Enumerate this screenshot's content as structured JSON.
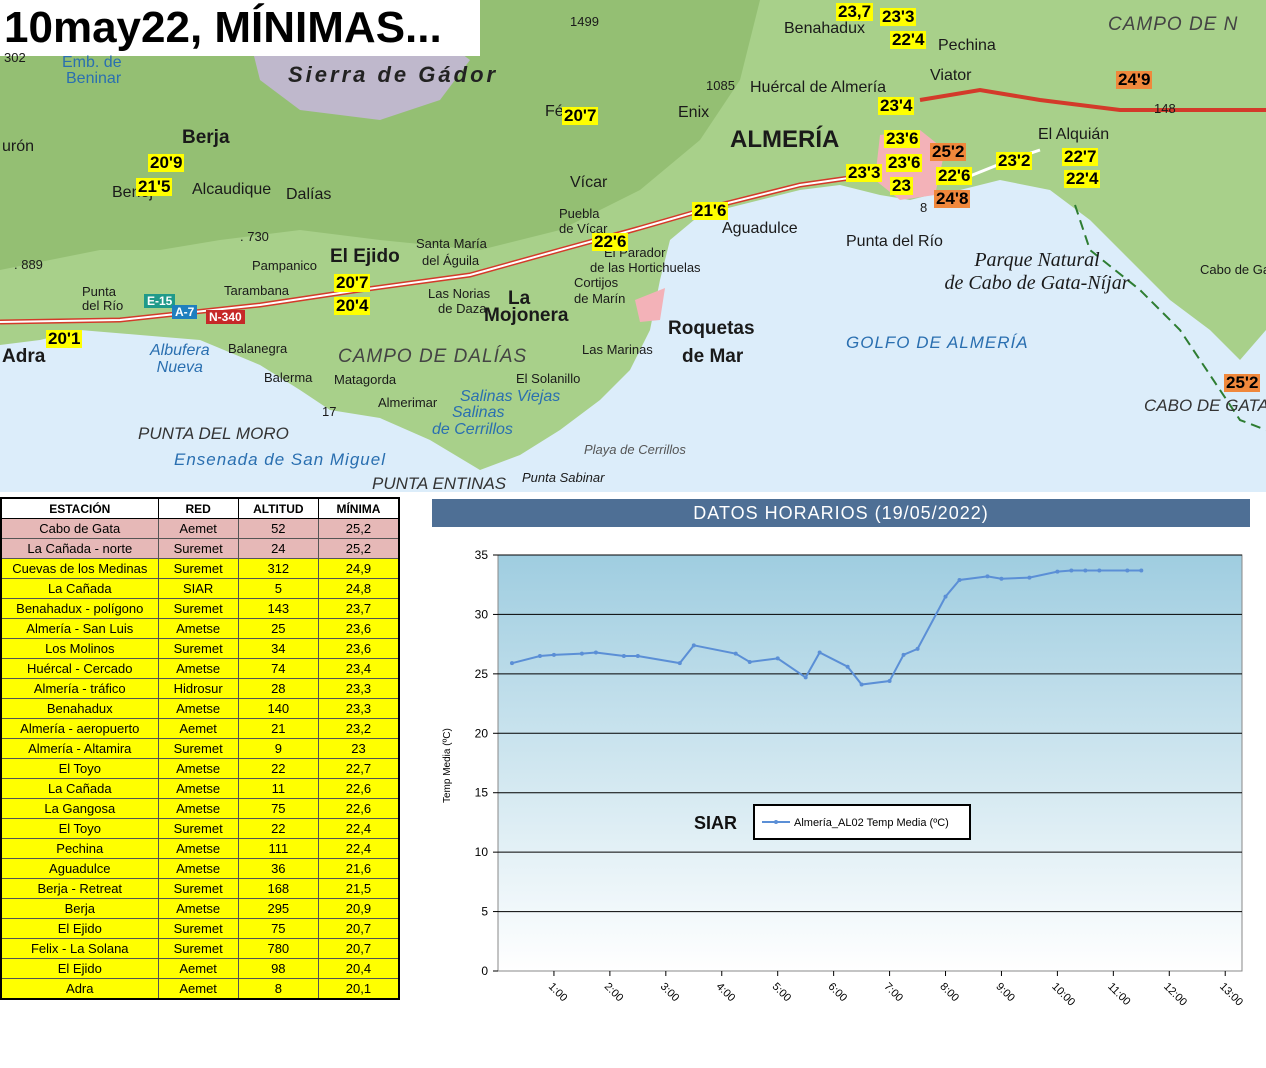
{
  "map": {
    "title": "10may22, MÍNIMAS...",
    "places": {
      "almeria": "ALMERÍA",
      "berja": "Berja",
      "dalias": "Dalías",
      "el_ejido": "El Ejido",
      "adra": "Adra",
      "roquetas": "Roquetas",
      "de_mar": "de Mar",
      "la_mojonera": "La",
      "la_mojonera2": "Mojonera",
      "benahadux": "Benahadux",
      "huercal": "Huércal de Almería",
      "viator": "Viator",
      "pechina": "Pechina",
      "enix": "Enix",
      "vicar": "Vícar",
      "felix": "Fé",
      "el_alquian": "El Alquián",
      "aguadulce": "Aguadulce",
      "punta_del_rio": "Punta del Río",
      "alcaudique": "Alcaudique",
      "benej": "Benej",
      "santa_maria": "Santa María",
      "del_aguila": "del Águila",
      "las_norias": "Las Norias",
      "de_daza": "de Daza",
      "pampanico": "Pampanico",
      "tarambana": "Tarambana",
      "balanegra": "Balanegra",
      "balerma": "Balerma",
      "matagorda": "Matagorda",
      "almerimar": "Almerimar",
      "el_solanillo": "El Solanillo",
      "las_marinas": "Las Marinas",
      "cortijos": "Cortijos",
      "de_marin": "de Marín",
      "el_parador": "El Parador",
      "de_las_hortichuelas": "de las Hortichuelas",
      "puebla": "Puebla",
      "de_vicar": "de Vícar",
      "punta_de_rio_w": "Punta",
      "del_rio_w": "del Río",
      "cabo_de_gata_town": "Cabo de Gat",
      "duron": "urón",
      "emb": "Emb. de",
      "beninar": "Beninar"
    },
    "regions": {
      "sierra": "Sierra de Gádor",
      "campo_dalias": "CAMPO DE DALÍAS",
      "campo_nijar": "CAMPO DE N",
      "parque1": "Parque Natural",
      "parque2": "de Cabo de Gata-Níjar",
      "golfo": "GOLFO DE ALMERÍA",
      "albufera1": "Albufera",
      "albufera2": "Nueva",
      "salinas1": "Salinas Viejas",
      "salinas2": "Salinas",
      "salinas3": "de Cerrillos",
      "playa": "Playa de Cerrillos",
      "punta_moro": "PUNTA DEL MORO",
      "ensenada": "Ensenada de San Miguel",
      "punta_entinas": "PUNTA ENTINAS",
      "punta_sabinar": "Punta Sabinar",
      "cabo_gata": "CABO DE GATA"
    },
    "elevations": {
      "e1499": "1499",
      "e1085": "1085",
      "e730": ". 730",
      "e889": ". 889",
      "e148": "148",
      "e302": "302",
      "e17": "17",
      "e8": "8"
    },
    "roads": {
      "e15": "E-15",
      "a7": "A-7",
      "n340": "N-340"
    },
    "temperatures": [
      {
        "id": "t1",
        "value": "23,7",
        "hot": false
      },
      {
        "id": "t2",
        "value": "23'3",
        "hot": false
      },
      {
        "id": "t3",
        "value": "22'4",
        "hot": false
      },
      {
        "id": "t4",
        "value": "24'9",
        "hot": true
      },
      {
        "id": "t5",
        "value": "20'7",
        "hot": false
      },
      {
        "id": "t6",
        "value": "23'4",
        "hot": false
      },
      {
        "id": "t7",
        "value": "23'6",
        "hot": false
      },
      {
        "id": "t8",
        "value": "25'2",
        "hot": true
      },
      {
        "id": "t9",
        "value": "23'6",
        "hot": false
      },
      {
        "id": "t10",
        "value": "23'2",
        "hot": false
      },
      {
        "id": "t11",
        "value": "22'7",
        "hot": false
      },
      {
        "id": "t12",
        "value": "23'3",
        "hot": false
      },
      {
        "id": "t13",
        "value": "23",
        "hot": false
      },
      {
        "id": "t14",
        "value": "22'6",
        "hot": false
      },
      {
        "id": "t15",
        "value": "22'4",
        "hot": false
      },
      {
        "id": "t16",
        "value": "24'8",
        "hot": true
      },
      {
        "id": "t17",
        "value": "20'9",
        "hot": false
      },
      {
        "id": "t18",
        "value": "21'5",
        "hot": false
      },
      {
        "id": "t19",
        "value": "21'6",
        "hot": false
      },
      {
        "id": "t20",
        "value": "22'6",
        "hot": false
      },
      {
        "id": "t21",
        "value": "20'7",
        "hot": false
      },
      {
        "id": "t22",
        "value": "20'4",
        "hot": false
      },
      {
        "id": "t23",
        "value": "20'1",
        "hot": false
      },
      {
        "id": "t24",
        "value": "25'2",
        "hot": true
      }
    ],
    "colors": {
      "sea": "#dcedfa",
      "land": "#a8d08a",
      "hot": "#f0883c",
      "label_bg": "#ffff00"
    }
  },
  "table": {
    "headers": [
      "ESTACIÓN",
      "RED",
      "ALTITUD",
      "MÍNIMA"
    ],
    "rows": [
      {
        "station": "Cabo de Gata",
        "network": "Aemet",
        "altitude": "52",
        "min": "25,2",
        "style": "pink"
      },
      {
        "station": "La Cañada - norte",
        "network": "Suremet",
        "altitude": "24",
        "min": "25,2",
        "style": "pink"
      },
      {
        "station": "Cuevas de los Medinas",
        "network": "Suremet",
        "altitude": "312",
        "min": "24,9",
        "style": "yellow"
      },
      {
        "station": "La Cañada",
        "network": "SIAR",
        "altitude": "5",
        "min": "24,8",
        "style": "yellow"
      },
      {
        "station": "Benahadux - polígono",
        "network": "Suremet",
        "altitude": "143",
        "min": "23,7",
        "style": "yellow"
      },
      {
        "station": "Almería - San Luis",
        "network": "Ametse",
        "altitude": "25",
        "min": "23,6",
        "style": "yellow"
      },
      {
        "station": "Los Molinos",
        "network": "Suremet",
        "altitude": "34",
        "min": "23,6",
        "style": "yellow"
      },
      {
        "station": "Huércal  - Cercado",
        "network": "Ametse",
        "altitude": "74",
        "min": "23,4",
        "style": "yellow"
      },
      {
        "station": "Almería - tráfico",
        "network": "Hidrosur",
        "altitude": "28",
        "min": "23,3",
        "style": "yellow"
      },
      {
        "station": "Benahadux",
        "network": "Ametse",
        "altitude": "140",
        "min": "23,3",
        "style": "yellow"
      },
      {
        "station": "Almería - aeropuerto",
        "network": "Aemet",
        "altitude": "21",
        "min": "23,2",
        "style": "yellow"
      },
      {
        "station": "Almería - Altamira",
        "network": "Suremet",
        "altitude": "9",
        "min": "23",
        "style": "yellow"
      },
      {
        "station": "El Toyo",
        "network": "Ametse",
        "altitude": "22",
        "min": "22,7",
        "style": "yellow"
      },
      {
        "station": "La Cañada",
        "network": "Ametse",
        "altitude": "11",
        "min": "22,6",
        "style": "yellow"
      },
      {
        "station": "La Gangosa",
        "network": "Ametse",
        "altitude": "75",
        "min": "22,6",
        "style": "yellow"
      },
      {
        "station": "El Toyo",
        "network": "Suremet",
        "altitude": "22",
        "min": "22,4",
        "style": "yellow"
      },
      {
        "station": "Pechina",
        "network": "Ametse",
        "altitude": "111",
        "min": "22,4",
        "style": "yellow"
      },
      {
        "station": "Aguadulce",
        "network": "Ametse",
        "altitude": "36",
        "min": "21,6",
        "style": "yellow"
      },
      {
        "station": "Berja - Retreat",
        "network": "Suremet",
        "altitude": "168",
        "min": "21,5",
        "style": "yellow"
      },
      {
        "station": "Berja",
        "network": "Ametse",
        "altitude": "295",
        "min": "20,9",
        "style": "yellow"
      },
      {
        "station": "El Ejido",
        "network": "Suremet",
        "altitude": "75",
        "min": "20,7",
        "style": "yellow"
      },
      {
        "station": "Felix - La Solana",
        "network": "Suremet",
        "altitude": "780",
        "min": "20,7",
        "style": "yellow"
      },
      {
        "station": "El Ejido",
        "network": "Aemet",
        "altitude": "98",
        "min": "20,4",
        "style": "yellow"
      },
      {
        "station": "Adra",
        "network": "Aemet",
        "altitude": "8",
        "min": "20,1",
        "style": "yellow"
      }
    ]
  },
  "chart": {
    "header": "DATOS HORARIOS (19/05/2022)",
    "watermark": "SIAR"
  },
  "chart_data": {
    "type": "line",
    "title": "DATOS HORARIOS (19/05/2022)",
    "ylabel": "Temp Media (ºC)",
    "xlabel": "",
    "ylim": [
      0,
      35
    ],
    "yticks": [
      0,
      5,
      10,
      15,
      20,
      25,
      30,
      35
    ],
    "xticks": [
      "1:00",
      "2:00",
      "3:00",
      "4:00",
      "5:00",
      "6:00",
      "7:00",
      "8:00",
      "9:00",
      "10:00",
      "11:00",
      "12:00",
      "13:00"
    ],
    "xlim": [
      0,
      13.3
    ],
    "grid": true,
    "legend_position": "center",
    "series": [
      {
        "name": "Almería_AL02 Temp Media (ºC)",
        "color": "#5b8fd6",
        "x": [
          0.25,
          0.75,
          1.0,
          1.5,
          1.75,
          2.25,
          2.5,
          3.25,
          3.5,
          4.25,
          4.5,
          5.0,
          5.5,
          5.75,
          6.25,
          6.5,
          7.0,
          7.25,
          7.5,
          8.0,
          8.25,
          8.75,
          9.0,
          9.5,
          10.0,
          10.25,
          10.5,
          10.75,
          11.25,
          11.5
        ],
        "y": [
          25.9,
          26.5,
          26.6,
          26.7,
          26.8,
          26.5,
          26.5,
          25.9,
          27.4,
          26.7,
          26.0,
          26.3,
          24.7,
          26.8,
          25.6,
          24.1,
          24.4,
          26.6,
          27.1,
          31.5,
          32.9,
          33.2,
          33.0,
          33.1,
          33.6,
          33.7,
          33.7,
          33.7,
          33.7,
          33.7
        ]
      }
    ]
  }
}
